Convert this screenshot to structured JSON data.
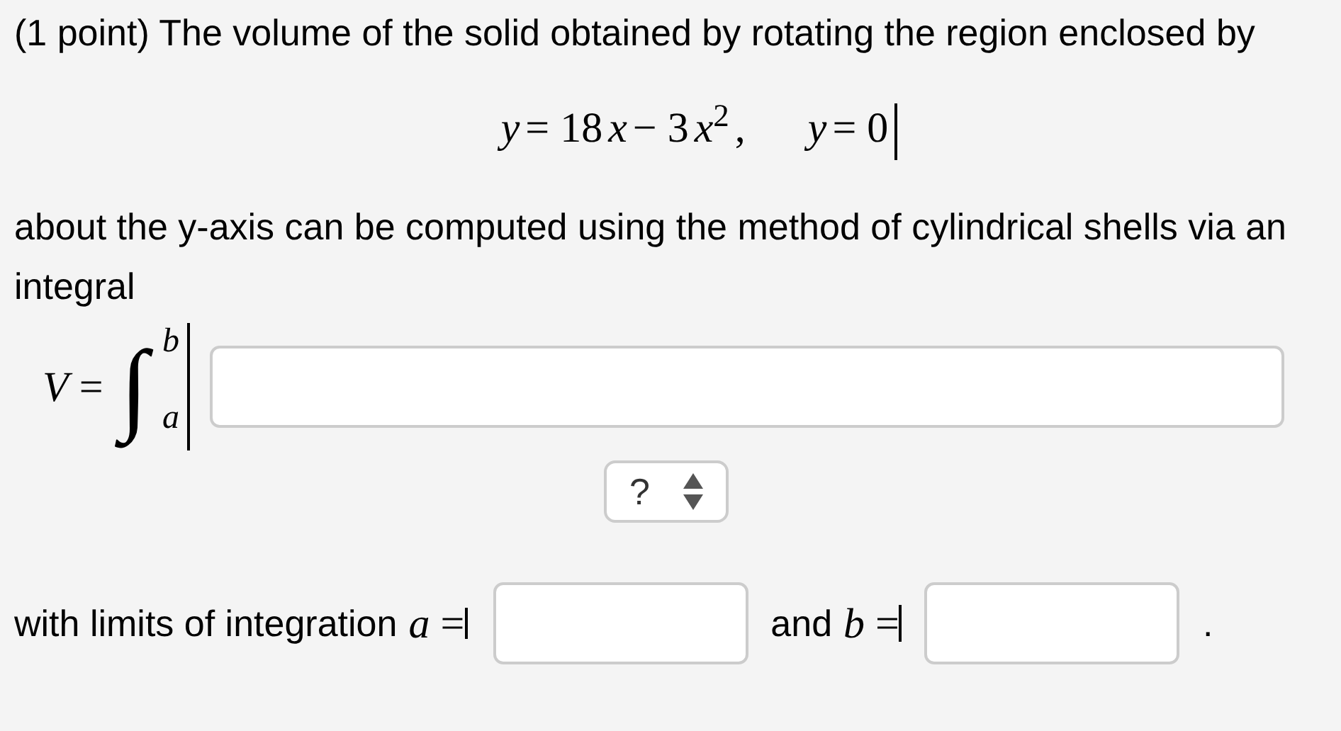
{
  "problem": {
    "intro": "(1 point) The volume of the solid obtained by rotating the region enclosed by",
    "equations": [
      [
        {
          "kind": "var",
          "text": "y"
        },
        {
          "kind": "op",
          "text": "= 18"
        },
        {
          "kind": "var",
          "text": "x"
        },
        {
          "kind": "op",
          "text": "− 3"
        },
        {
          "kind": "var",
          "text": "x"
        },
        {
          "kind": "sup",
          "text": "2"
        },
        {
          "kind": "op",
          "text": ","
        }
      ],
      [
        {
          "kind": "var",
          "text": "y"
        },
        {
          "kind": "op",
          "text": "= 0"
        }
      ]
    ],
    "method_text": "about the y-axis can be computed using the method of cylindrical shells via an integral",
    "integral": {
      "lhs": "*V* =",
      "symbol": "∫",
      "upper": "b",
      "lower": "a"
    },
    "answer_type_select": {
      "value": "?"
    },
    "limits": {
      "text": "with limits of integration",
      "a_label": "*a* =",
      "and_text": "and",
      "b_label": "*b* =",
      "end": "."
    }
  }
}
